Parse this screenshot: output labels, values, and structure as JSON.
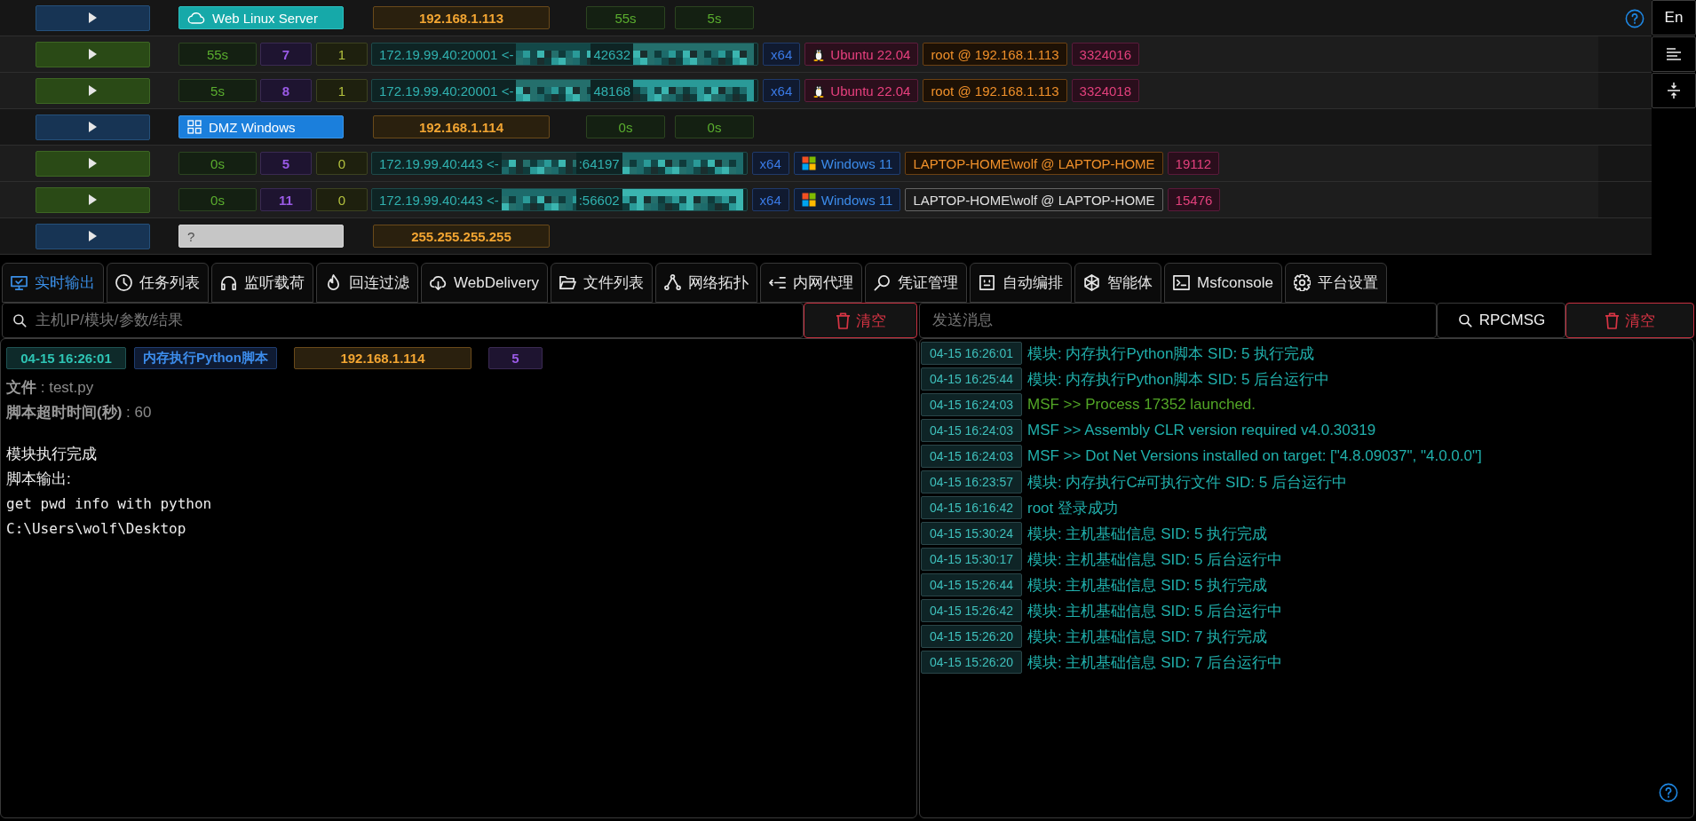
{
  "session_table": {
    "rows": [
      {
        "kind": "group",
        "tag": {
          "kind": "linux",
          "label": "Web Linux Server"
        },
        "ip": "192.168.1.113",
        "times": [
          "55s",
          "5s"
        ]
      },
      {
        "kind": "session",
        "time": "55s",
        "sid": "7",
        "column_4": "1",
        "connection": [
          "172.19.99.40:20001 <-",
          "42632"
        ],
        "arch": "x64",
        "os": {
          "kind": "linux",
          "name": "Ubuntu 22.04"
        },
        "user": {
          "text": "root @ 192.168.1.113",
          "color": "#f0902a"
        },
        "pid": "3324016"
      },
      {
        "kind": "session",
        "time": "5s",
        "sid": "8",
        "column_4": "1",
        "connection": [
          "172.19.99.40:20001 <-",
          "48168"
        ],
        "arch": "x64",
        "os": {
          "kind": "linux",
          "name": "Ubuntu 22.04"
        },
        "user": {
          "text": "root @ 192.168.1.113",
          "color": "#f0902a"
        },
        "pid": "3324018"
      },
      {
        "kind": "group",
        "tag": {
          "kind": "windows",
          "label": "DMZ Windows"
        },
        "ip": "192.168.1.114",
        "times": [
          "0s",
          "0s"
        ]
      },
      {
        "kind": "session",
        "time": "0s",
        "sid": "5",
        "column_4": "0",
        "connection": [
          "172.19.99.40:443 <-",
          ":64197"
        ],
        "arch": "x64",
        "os": {
          "kind": "windows",
          "name": "Windows 11"
        },
        "user": {
          "text": "LAPTOP-HOME\\wolf @ LAPTOP-HOME",
          "color": "#f0902a"
        },
        "pid": "19112"
      },
      {
        "kind": "session",
        "time": "0s",
        "sid": "11",
        "column_4": "0",
        "connection": [
          "172.19.99.40:443 <-",
          ":56602"
        ],
        "arch": "x64",
        "os": {
          "kind": "windows",
          "name": "Windows 11"
        },
        "user": {
          "text": "LAPTOP-HOME\\wolf @ LAPTOP-HOME",
          "color": "#e0e0e0"
        },
        "pid": "15476"
      },
      {
        "kind": "group",
        "tag": {
          "kind": "unknown",
          "label": "?"
        },
        "ip": "255.255.255.255"
      }
    ]
  },
  "toolbar": {
    "language_button": "En"
  },
  "tabs": [
    {
      "label": "实时输出",
      "selected": true
    },
    {
      "label": "任务列表",
      "selected": false
    },
    {
      "label": "监听载荷",
      "selected": false
    },
    {
      "label": "回连过滤",
      "selected": false
    },
    {
      "label": "WebDelivery",
      "selected": false
    },
    {
      "label": "文件列表",
      "selected": false
    },
    {
      "label": "网络拓扑",
      "selected": false
    },
    {
      "label": "内网代理",
      "selected": false
    },
    {
      "label": "凭证管理",
      "selected": false
    },
    {
      "label": "自动编排",
      "selected": false
    },
    {
      "label": "智能体",
      "selected": false
    },
    {
      "label": "Msfconsole",
      "selected": false
    },
    {
      "label": "平台设置",
      "selected": false
    }
  ],
  "left_panel": {
    "filter_field": {
      "placeholder": "主机IP/模块/参数/结果"
    },
    "clear_button": "清空",
    "output": {
      "time": "04-15 16:26:01",
      "module": "内存执行Python脚本",
      "ip": "192.168.1.114",
      "sid": "5",
      "params": [
        "**文件** : test.py",
        "**脚本超时时间(秒)** : 60"
      ],
      "result_lines": [
        "模块执行完成",
        "脚本输出:"
      ],
      "output_lines": [
        "get pwd info with python",
        "C:\\Users\\wolf\\Desktop"
      ]
    }
  },
  "right_panel": {
    "message_field": {
      "placeholder": "发送消息"
    },
    "rpc_button": "RPCMSG",
    "clear_button": "清空",
    "messages": [
      {
        "time": "04-15 16:26:01",
        "text": "模块: 内存执行Python脚本 SID: 5 执行完成",
        "color": "#20b0ac"
      },
      {
        "time": "04-15 16:25:44",
        "text": "模块: 内存执行Python脚本 SID: 5 后台运行中",
        "color": "#20b0ac"
      },
      {
        "time": "04-15 16:24:03",
        "text": "MSF >> Process 17352 launched.",
        "color": "#52a626"
      },
      {
        "time": "04-15 16:24:03",
        "text": "MSF >> Assembly CLR version required v4.0.30319",
        "color": "#20b0ac"
      },
      {
        "time": "04-15 16:24:03",
        "text": "MSF >> Dot Net Versions installed on target: [\"4.8.09037\", \"4.0.0.0\"]",
        "color": "#20b0ac"
      },
      {
        "time": "04-15 16:23:57",
        "text": "模块: 内存执行C#可执行文件 SID: 5 后台运行中",
        "color": "#20b0ac"
      },
      {
        "time": "04-15 16:16:42",
        "text": "root 登录成功",
        "color": "#20b0ac"
      },
      {
        "time": "04-15 15:30:24",
        "text": "模块: 主机基础信息 SID: 5 执行完成",
        "color": "#20b0ac"
      },
      {
        "time": "04-15 15:30:17",
        "text": "模块: 主机基础信息 SID: 5 后台运行中",
        "color": "#20b0ac"
      },
      {
        "time": "04-15 15:26:44",
        "text": "模块: 主机基础信息 SID: 5 执行完成",
        "color": "#20b0ac"
      },
      {
        "time": "04-15 15:26:42",
        "text": "模块: 主机基础信息 SID: 5 后台运行中",
        "color": "#20b0ac"
      },
      {
        "time": "04-15 15:26:20",
        "text": "模块: 主机基础信息 SID: 7 执行完成",
        "color": "#20b0ac"
      },
      {
        "time": "04-15 15:26:20",
        "text": "模块: 主机基础信息 SID: 7 后台运行中",
        "color": "#20b0ac"
      }
    ]
  }
}
